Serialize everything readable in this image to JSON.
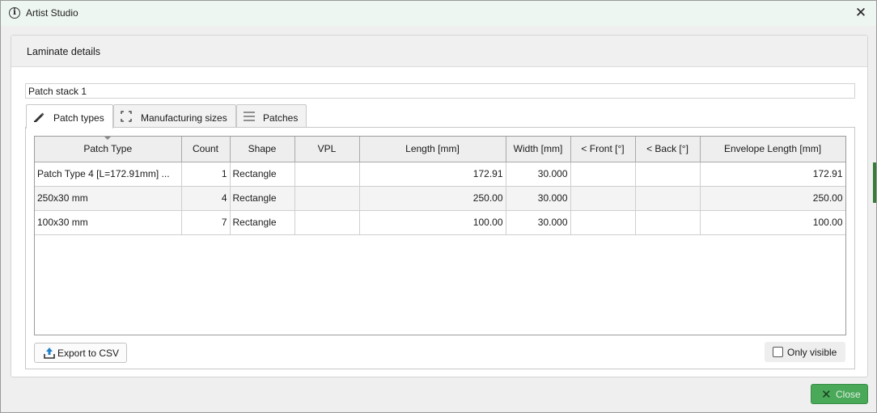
{
  "window": {
    "title": "Artist Studio",
    "close_glyph": "✕"
  },
  "panel": {
    "title": "Laminate details"
  },
  "stack": {
    "name": "Patch stack 1"
  },
  "tabs": [
    {
      "label": "Patch types",
      "icon": "ruler-pen-icon",
      "active": true
    },
    {
      "label": "Manufacturing sizes",
      "icon": "expand-corners-icon",
      "active": false
    },
    {
      "label": "Patches",
      "icon": "list-lines-icon",
      "active": false
    }
  ],
  "grid": {
    "sorted_column": "Patch Type",
    "columns": [
      "Patch Type",
      "Count",
      "Shape",
      "VPL",
      "Length [mm]",
      "Width [mm]",
      "< Front [°]",
      "< Back [°]",
      "Envelope Length [mm]"
    ],
    "rows": [
      [
        "Patch Type 4 [L=172.91mm] ...",
        "1",
        "Rectangle",
        "",
        "172.91",
        "30.000",
        "",
        "",
        "172.91"
      ],
      [
        "250x30 mm",
        "4",
        "Rectangle",
        "",
        "250.00",
        "30.000",
        "",
        "",
        "250.00"
      ],
      [
        "100x30 mm",
        "7",
        "Rectangle",
        "",
        "100.00",
        "30.000",
        "",
        "",
        "100.00"
      ]
    ]
  },
  "actions": {
    "export_label": "Export to CSV",
    "only_visible_label": "Only visible",
    "only_visible_checked": false,
    "close_label": "Close",
    "close_glyph": "✕"
  },
  "colors": {
    "close_button": "#4aa859",
    "title_bar": "#eef6f1"
  }
}
